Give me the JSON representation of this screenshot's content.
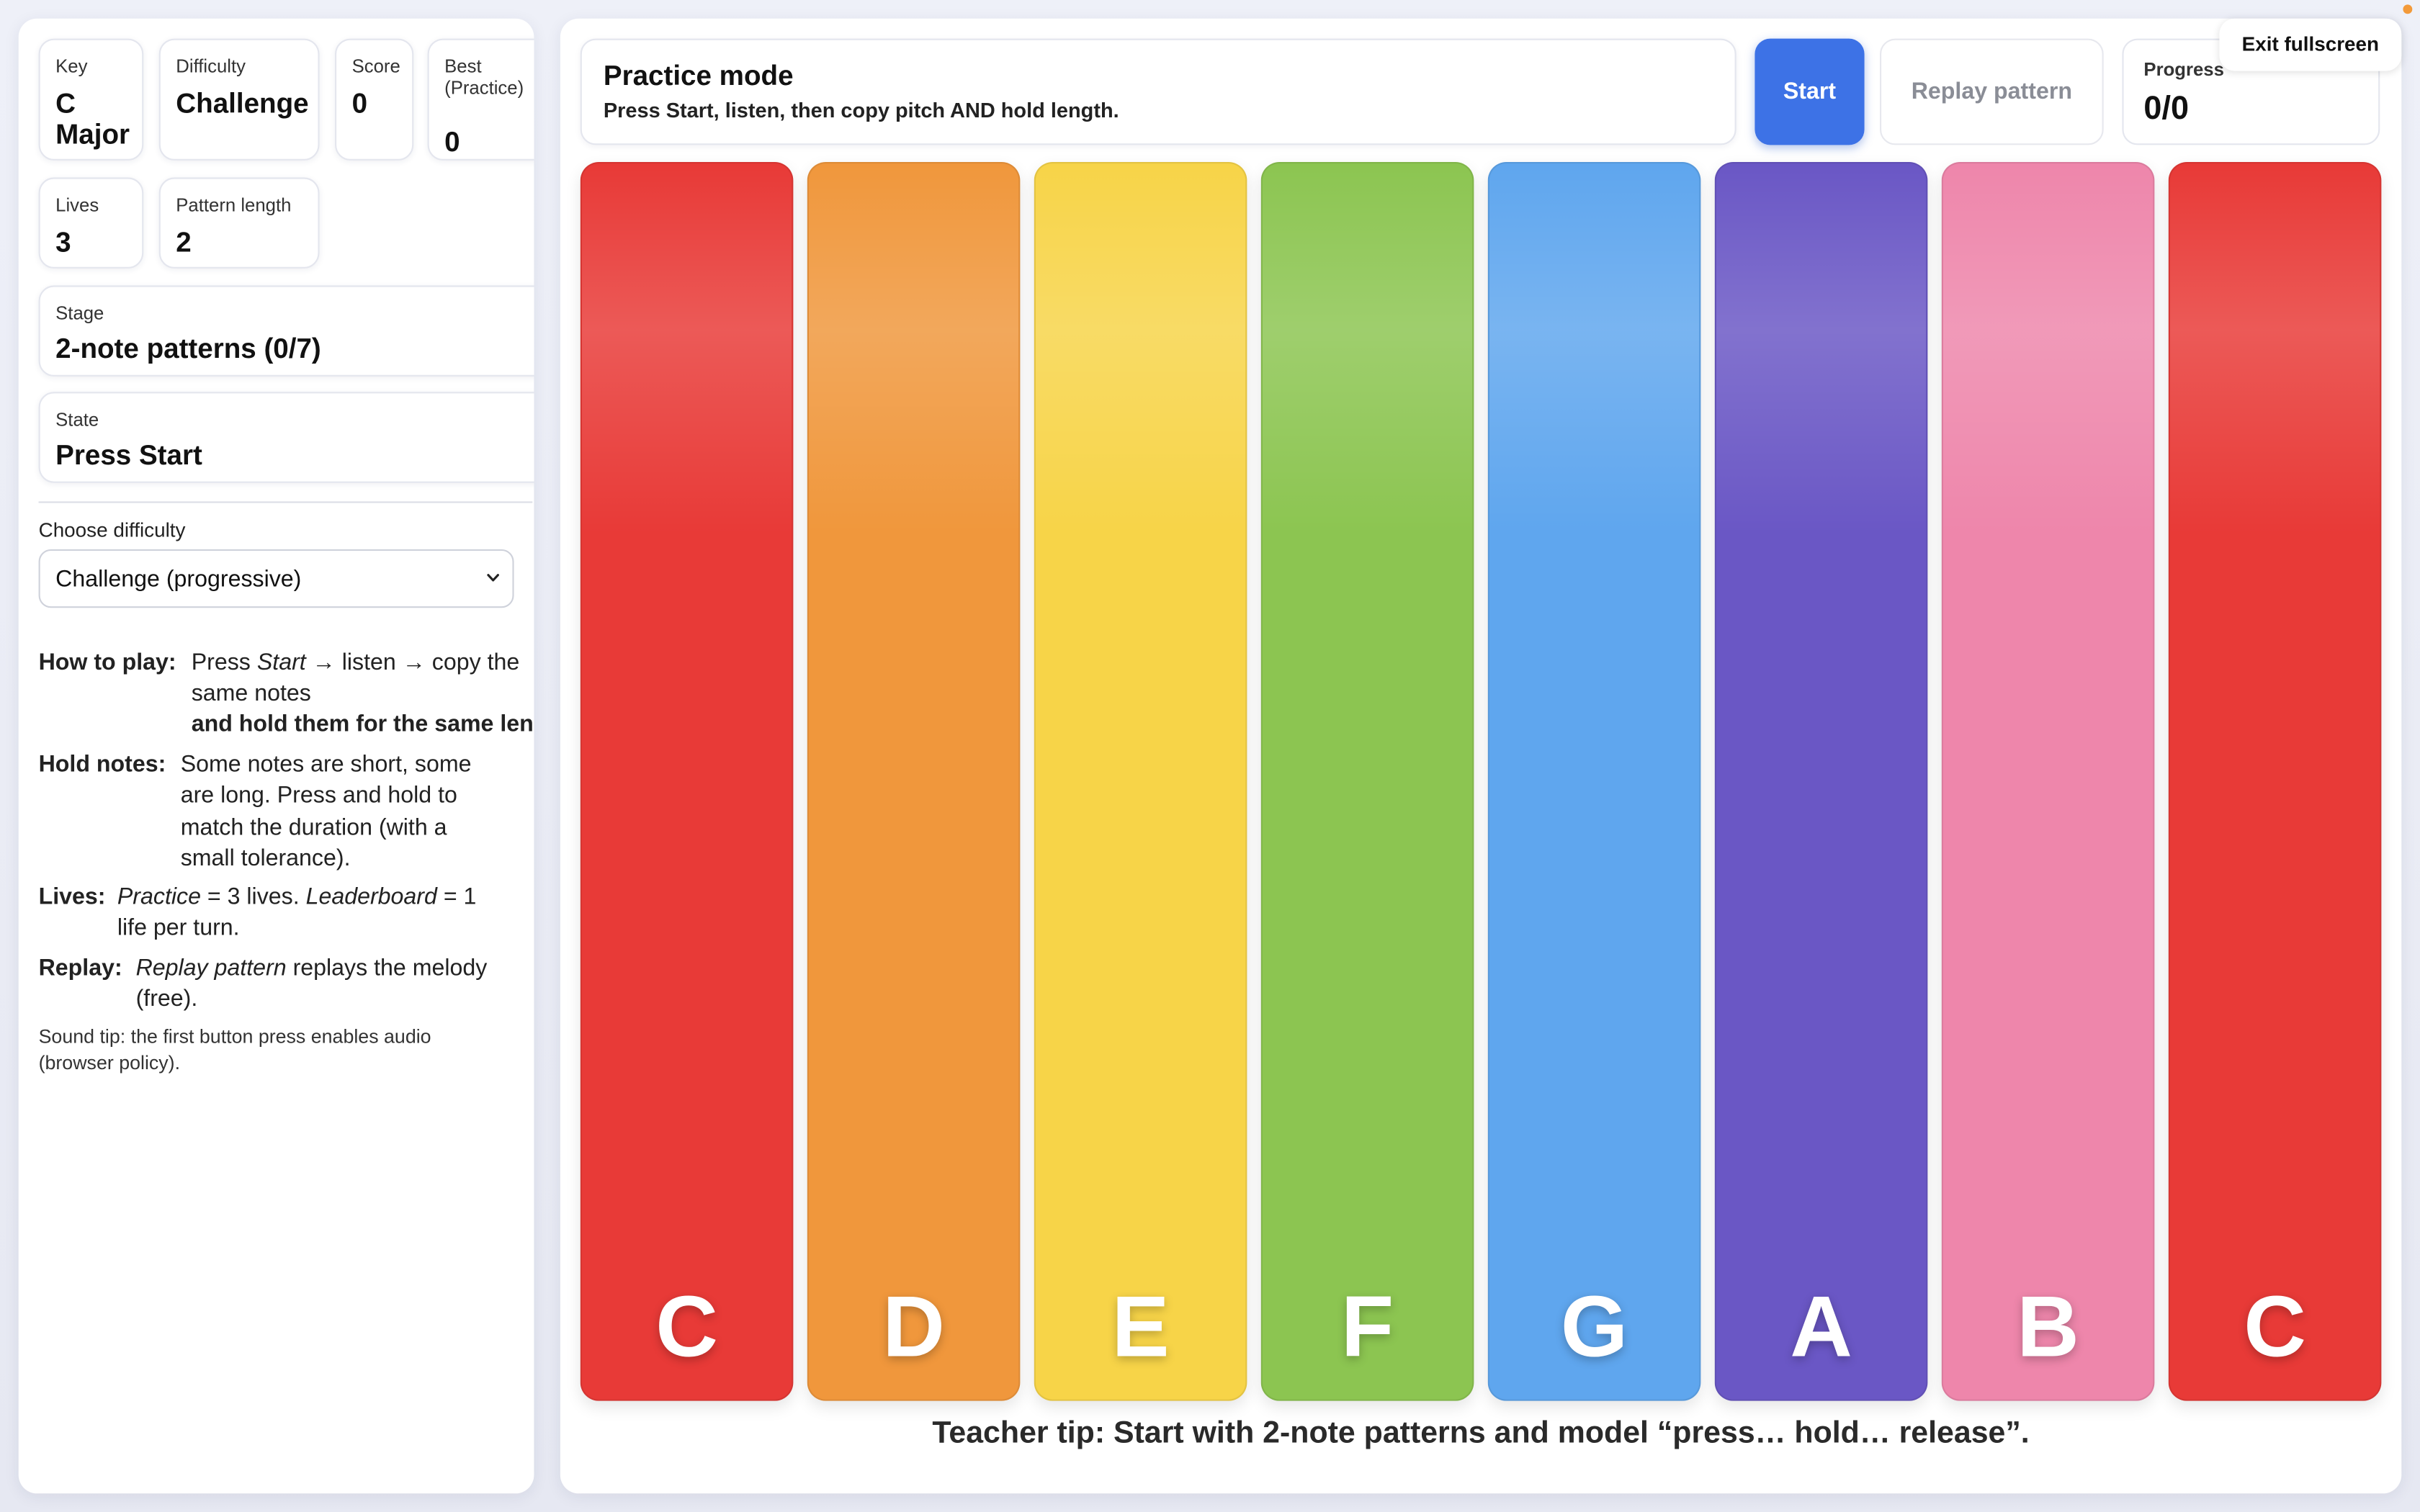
{
  "stats": {
    "key_label": "Key",
    "key_value_1": "C",
    "key_value_2": "Major",
    "difficulty_label": "Difficulty",
    "difficulty_value": "Challenge",
    "score_label": "Score",
    "score_value": "0",
    "best_label_1": "Best",
    "best_label_2": "(Practice)",
    "best_value": "0",
    "lives_label": "Lives",
    "lives_value": "3",
    "pattern_length_label": "Pattern length",
    "pattern_length_value": "2",
    "stage_label": "Stage",
    "stage_value": "2-note patterns (0/7)",
    "state_label": "State",
    "state_value": "Press Start"
  },
  "difficulty_select": {
    "label": "Choose difficulty",
    "selected": "Challenge (progressive)"
  },
  "help": {
    "how_key": "How to play:",
    "how_a": "Press ",
    "how_b": "Start",
    "how_c": " → listen → copy the",
    "how_line2": "same notes",
    "how_line3": "and hold them for the same length",
    "hold_key": "Hold notes:",
    "hold_l1": "Some notes are short, some",
    "hold_l2": "are long. Press and hold to",
    "hold_l3": "match the duration (with a",
    "hold_l4": "small tolerance).",
    "lives_key": "Lives:",
    "lives_a": "Practice",
    "lives_b": " = 3 lives. ",
    "lives_c": "Leaderboard",
    "lives_d": " = 1",
    "lives_l2": "life per turn.",
    "replay_key": "Replay:",
    "replay_a": "Replay pattern",
    "replay_b": " replays the melody",
    "replay_l2": "(free).",
    "sound_tip": "Sound tip: the first button press enables audio (browser policy)."
  },
  "mode": {
    "title": "Practice mode",
    "subtitle": "Press Start, listen, then copy pitch AND hold length."
  },
  "buttons": {
    "start": "Start",
    "replay": "Replay pattern",
    "exit_fullscreen": "Exit fullscreen"
  },
  "progress": {
    "label": "Progress",
    "value": "0/0"
  },
  "keys": [
    {
      "note": "C",
      "color": "#e83a37"
    },
    {
      "note": "D",
      "color": "#f0973c"
    },
    {
      "note": "E",
      "color": "#f7d448"
    },
    {
      "note": "F",
      "color": "#8cc551"
    },
    {
      "note": "G",
      "color": "#5fa6ee"
    },
    {
      "note": "A",
      "color": "#6a57c5"
    },
    {
      "note": "B",
      "color": "#ee86ab"
    },
    {
      "note": "C",
      "color": "#e83a37"
    }
  ],
  "teacher_tip": "Teacher tip: Start with 2-note patterns and model “press… hold… release”.",
  "icons": {
    "select_chevron": "chevron-down-icon"
  }
}
